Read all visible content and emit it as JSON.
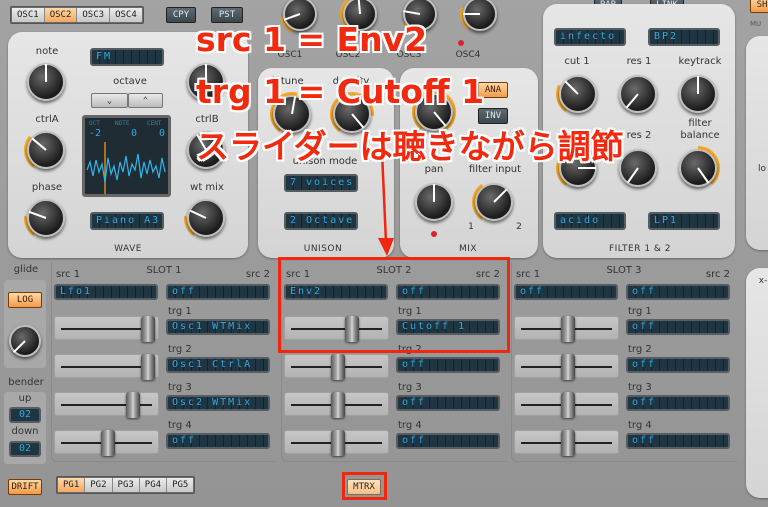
{
  "osc_tabs": [
    {
      "label": "OSC1",
      "active": false
    },
    {
      "label": "OSC2",
      "active": true
    },
    {
      "label": "OSC3",
      "active": false
    },
    {
      "label": "OSC4",
      "active": false
    }
  ],
  "copy_label": "CPY",
  "paste_label": "PST",
  "osc_level_labels": [
    "OSC1",
    "OSC2",
    "OSC3",
    "OSC4"
  ],
  "wave": {
    "section": "WAVE",
    "note": "note",
    "ctrlA": "ctrlA",
    "ctrlB": "ctrlB",
    "phase": "phase",
    "wt_mix": "wt mix",
    "octave": "octave",
    "type_display": "FM",
    "wavetable_display": "Piano A3",
    "scope": {
      "oct_label": "OCT",
      "note_label": "NOTE",
      "cent_label": "CENT",
      "oct": "-2",
      "note": "0",
      "cent": "0"
    },
    "octave_down": "⌄",
    "octave_up": "⌃"
  },
  "unison": {
    "section": "UNISON",
    "detune": "detune",
    "density": "density",
    "mode_label": "unison mode",
    "mode": "7 voices",
    "range": "2 Octave"
  },
  "mix": {
    "section": "MIX",
    "ana": "ANA",
    "inv": "INV",
    "pan": "pan",
    "filter_input": "filter input",
    "fi_min": "1",
    "fi_max": "2"
  },
  "filter": {
    "section": "FILTER 1 & 2",
    "par": "PAR",
    "link": "LINK",
    "type1": "infecto",
    "type2": "BP2",
    "cut1": "cut 1",
    "res1": "res 1",
    "keytrack": "keytrack",
    "cut2": "cut 2",
    "res2": "res 2",
    "balance": "filter balance",
    "type3": "acido",
    "type4": "LP1"
  },
  "right_edge": {
    "sh": "SH",
    "mu": "MU",
    "lo": "lo",
    "x": "x-"
  },
  "glide": {
    "label": "glide",
    "log": "LOG"
  },
  "bender": {
    "label": "bender",
    "up_label": "up",
    "up": "02",
    "down_label": "down",
    "down": "02"
  },
  "drift": "DRIFT",
  "pages": [
    {
      "label": "PG1",
      "active": true
    },
    {
      "label": "PG2",
      "active": false
    },
    {
      "label": "PG3",
      "active": false
    },
    {
      "label": "PG4",
      "active": false
    },
    {
      "label": "PG5",
      "active": false
    }
  ],
  "mtrx": "MTRX",
  "matrix": {
    "src1": "src 1",
    "src2": "src 2",
    "slots": [
      {
        "title": "SLOT 1",
        "src1": "Lfo1",
        "src2": "off",
        "targets": [
          {
            "label": "trg 1",
            "value": "Osc1 WTMix",
            "amount": 0.95
          },
          {
            "label": "trg 2",
            "value": "Osc1 CtrlA",
            "amount": 0.95
          },
          {
            "label": "trg 3",
            "value": "Osc2 WTMix",
            "amount": 0.78
          },
          {
            "label": "trg 4",
            "value": "off",
            "amount": 0.5
          }
        ]
      },
      {
        "title": "SLOT 2",
        "src1": "Env2",
        "src2": "off",
        "targets": [
          {
            "label": "trg 1",
            "value": "Cutoff 1",
            "amount": 0.66
          },
          {
            "label": "trg 2",
            "value": "off",
            "amount": 0.5
          },
          {
            "label": "trg 3",
            "value": "off",
            "amount": 0.5
          },
          {
            "label": "trg 4",
            "value": "off",
            "amount": 0.5
          }
        ]
      },
      {
        "title": "SLOT 3",
        "src1": "off",
        "src2": "off",
        "targets": [
          {
            "label": "trg 1",
            "value": "off",
            "amount": 0.5
          },
          {
            "label": "trg 2",
            "value": "off",
            "amount": 0.5
          },
          {
            "label": "trg 3",
            "value": "off",
            "amount": 0.5
          },
          {
            "label": "trg 4",
            "value": "off",
            "amount": 0.5
          }
        ]
      }
    ]
  },
  "annotation": {
    "line1": "src 1 = Env2",
    "line2": "trg 1 = Cutoff 1",
    "line3": "スライダーは聴きながら調節"
  },
  "colors": {
    "accent": "#f5a623",
    "lcd_text": "#31a9e0",
    "annotation": "#f0260e"
  }
}
